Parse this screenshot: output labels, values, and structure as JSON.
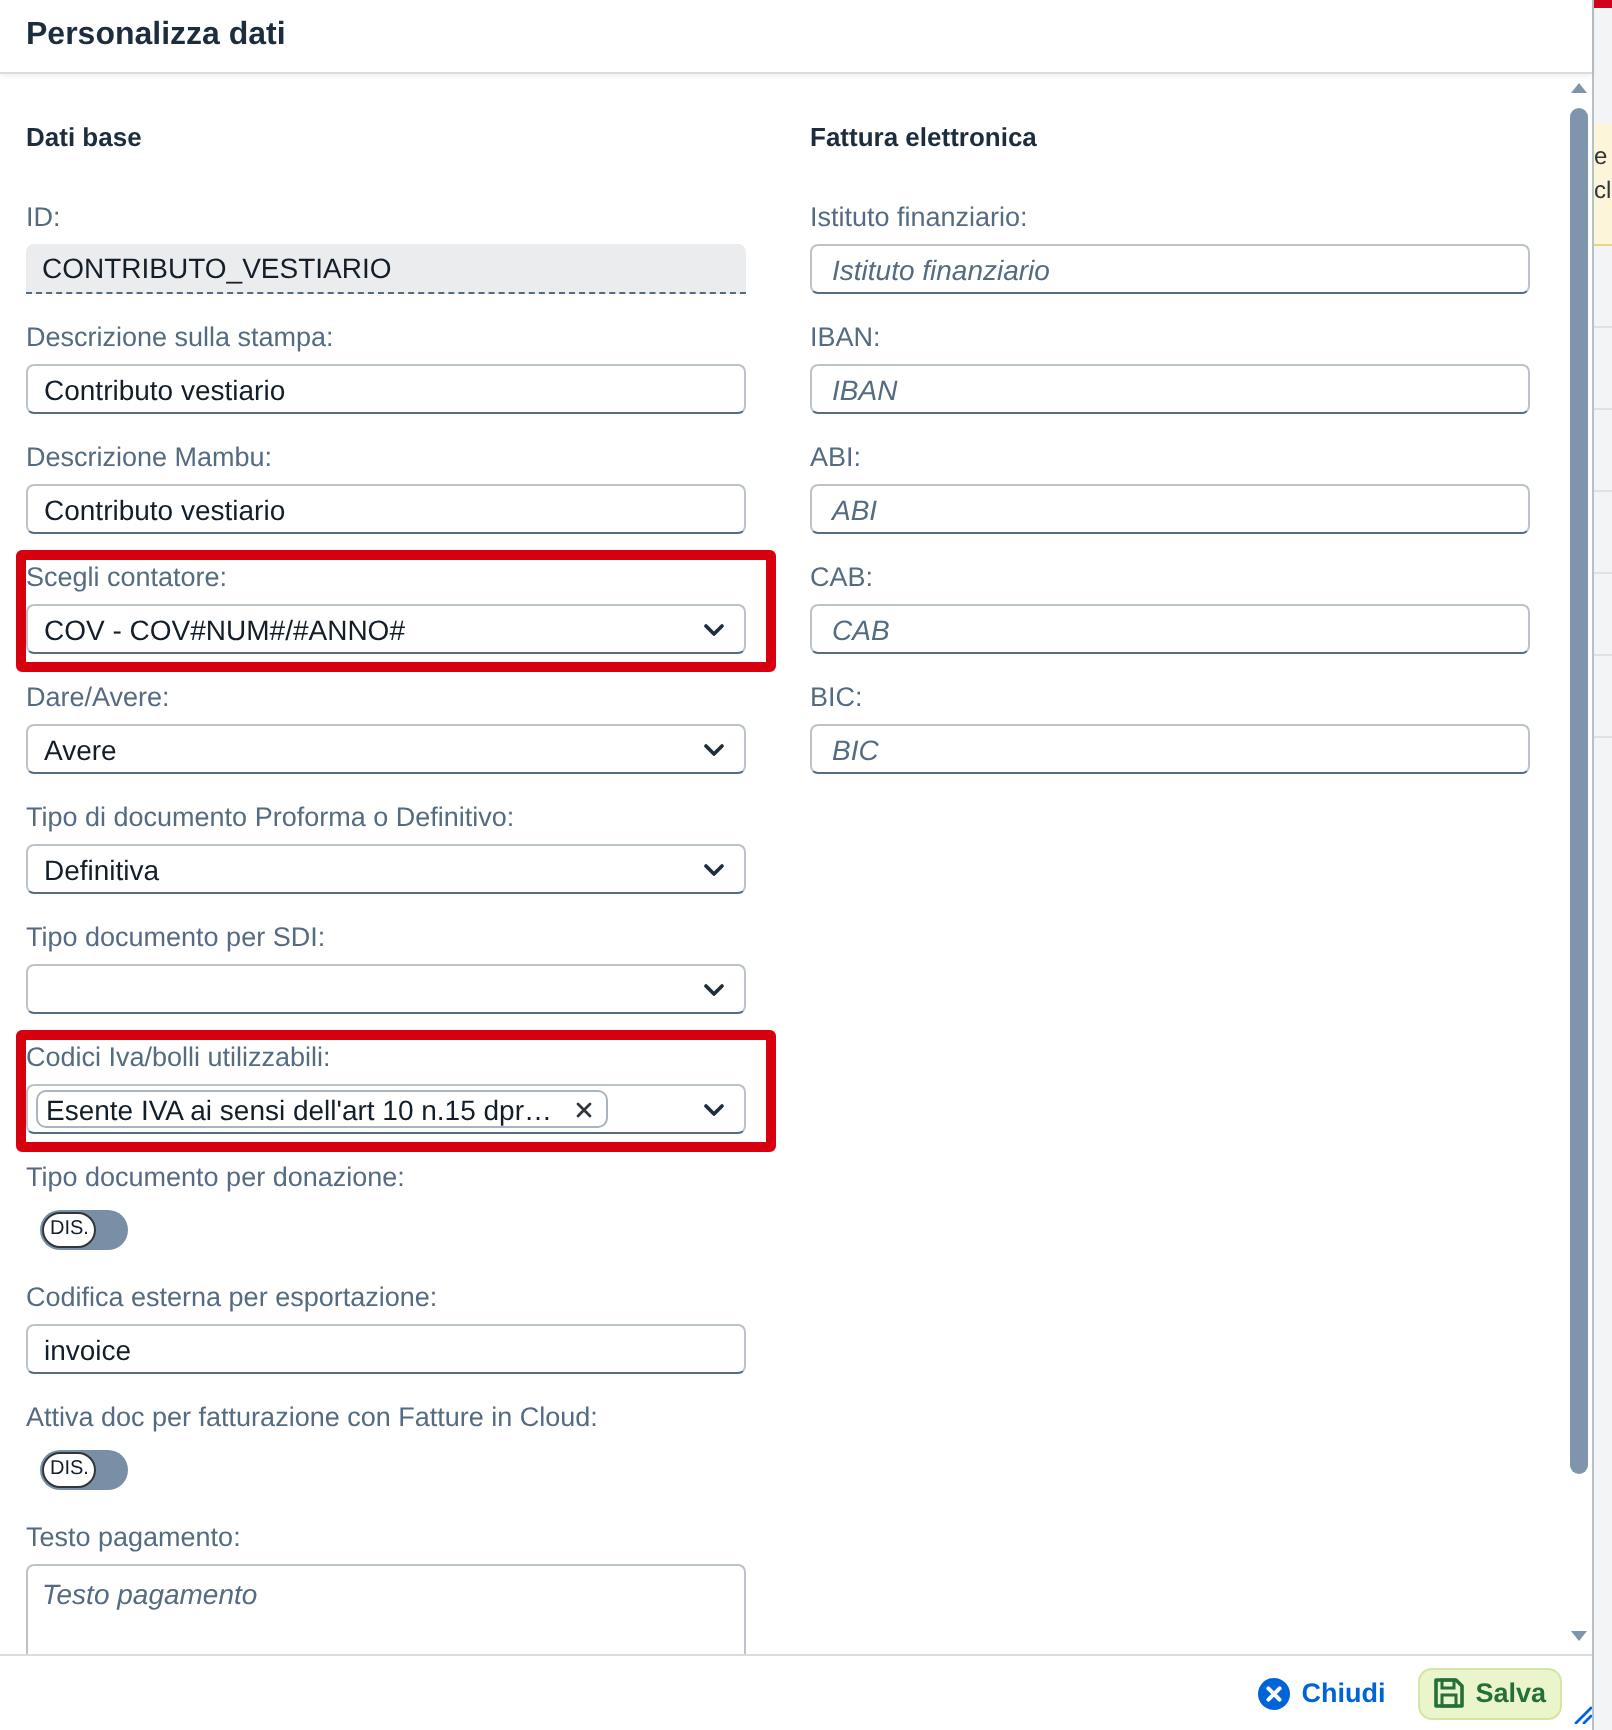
{
  "dialog": {
    "title": "Personalizza dati"
  },
  "sections": [
    {
      "heading": "Dati base",
      "fields": [
        {
          "kind": "readonly",
          "label": "ID:",
          "value": "CONTRIBUTO_VESTIARIO",
          "highlighted": false
        },
        {
          "kind": "text",
          "label": "Descrizione sulla stampa:",
          "value": "Contributo vestiario",
          "highlighted": false
        },
        {
          "kind": "text",
          "label": "Descrizione Mambu:",
          "value": "Contributo vestiario",
          "highlighted": false
        },
        {
          "kind": "select",
          "label": "Scegli contatore:",
          "value": "COV - COV#NUM#/#ANNO#",
          "highlighted": true
        },
        {
          "kind": "select",
          "label": "Dare/Avere:",
          "value": "Avere",
          "highlighted": false
        },
        {
          "kind": "select",
          "label": "Tipo di documento Proforma o Definitivo:",
          "value": "Definitiva",
          "highlighted": false
        },
        {
          "kind": "select",
          "label": "Tipo documento per SDI:",
          "highlighted": false
        },
        {
          "kind": "multiselect",
          "label": "Codici Iva/bolli utilizzabili:",
          "tokens": [
            "Esente IVA ai sensi dell'art 10 n.15 dpr…"
          ],
          "highlighted": true
        },
        {
          "kind": "switch",
          "label": "Tipo documento per donazione:",
          "on": false,
          "switch_text": "DIS.",
          "highlighted": false
        },
        {
          "kind": "text",
          "label": "Codifica esterna per esportazione:",
          "value": "invoice",
          "highlighted": false
        },
        {
          "kind": "switch",
          "label": "Attiva doc per fatturazione con Fatture in Cloud:",
          "on": false,
          "switch_text": "DIS.",
          "highlighted": false
        },
        {
          "kind": "textarea",
          "label": "Testo pagamento:",
          "placeholder": "Testo pagamento",
          "highlighted": false
        }
      ]
    },
    {
      "heading": "Fattura elettronica",
      "fields": [
        {
          "kind": "text",
          "label": "Istituto finanziario:",
          "placeholder": "Istituto finanziario",
          "highlighted": false
        },
        {
          "kind": "text",
          "label": "IBAN:",
          "placeholder": "IBAN",
          "highlighted": false
        },
        {
          "kind": "text",
          "label": "ABI:",
          "placeholder": "ABI",
          "highlighted": false
        },
        {
          "kind": "text",
          "label": "CAB:",
          "placeholder": "CAB",
          "highlighted": false
        },
        {
          "kind": "text",
          "label": "BIC:",
          "placeholder": "BIC",
          "highlighted": false
        }
      ]
    }
  ],
  "footer": {
    "buttons": [
      {
        "kind": "close",
        "label": "Chiudi"
      },
      {
        "kind": "save",
        "label": "Salva"
      }
    ]
  },
  "background_page": {
    "note_texts": [
      "e",
      "cl"
    ]
  }
}
